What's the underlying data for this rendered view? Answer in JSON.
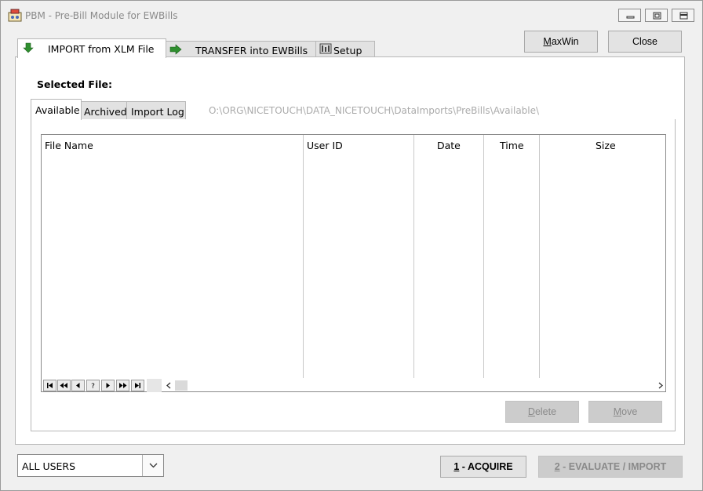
{
  "window": {
    "title": "PBM - Pre-Bill Module for EWBills"
  },
  "top_tabs": [
    {
      "label": "IMPORT from XLM File",
      "icon": "green-down-arrow-icon",
      "active": true
    },
    {
      "label": "TRANSFER into EWBills",
      "icon": "green-right-arrow-icon",
      "active": false
    },
    {
      "label": "Setup",
      "icon": "settings-grid-icon",
      "active": false
    }
  ],
  "buttons": {
    "maxwin": {
      "mnemonic": "M",
      "rest": "axWin"
    },
    "close": "Close",
    "delete": {
      "mnemonic": "D",
      "rest": "elete"
    },
    "move": {
      "mnemonic": "M",
      "rest": "ove"
    },
    "acquire": {
      "mnemonic": "1",
      "rest": " - ACQUIRE"
    },
    "evaluate": {
      "mnemonic": "2",
      "rest": " - EVALUATE / IMPORT"
    }
  },
  "selected_file_label": "Selected File:",
  "inner_tabs": [
    {
      "label": "Available",
      "active": true
    },
    {
      "label": "Archived",
      "active": false
    },
    {
      "label": "Import Log",
      "active": false
    }
  ],
  "path": "O:\\ORG\\NICETOUCH\\DATA_NICETOUCH\\DataImports\\PreBills\\Available\\",
  "grid": {
    "columns": [
      "File Name",
      "User ID",
      "Date",
      "Time",
      "Size"
    ],
    "rows": [],
    "nav_buttons": [
      "first",
      "prev-page",
      "prev",
      "?",
      "next",
      "next-page",
      "last"
    ]
  },
  "user_filter": {
    "value": "ALL USERS"
  },
  "colors": {
    "accent_green": "#2f8f2f",
    "disabled_text": "#8a8a8a",
    "path_text": "#ababab"
  }
}
